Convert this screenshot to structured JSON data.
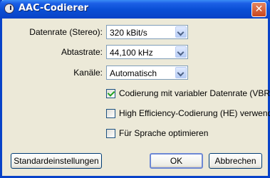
{
  "window": {
    "title": "AAC-Codierer",
    "close_glyph": "✕"
  },
  "fields": [
    {
      "label": "Datenrate (Stereo):",
      "value": "320 kBit/s"
    },
    {
      "label": "Abtastrate:",
      "value": "44,100 kHz"
    },
    {
      "label": "Kanäle:",
      "value": "Automatisch"
    }
  ],
  "options": [
    {
      "label": "Codierung mit variabler Datenrate (VBR)",
      "checked": true
    },
    {
      "label": "High Efficiency-Codierung (HE) verwenden",
      "checked": false
    },
    {
      "label": "Für Sprache optimieren",
      "checked": false
    }
  ],
  "buttons": {
    "defaults": "Standardeinstellungen",
    "ok": "OK",
    "cancel": "Abbrechen"
  },
  "colors": {
    "titlebar": "#0a4fd6",
    "window_bg": "#ece9d8",
    "check_mark": "#21a121"
  }
}
